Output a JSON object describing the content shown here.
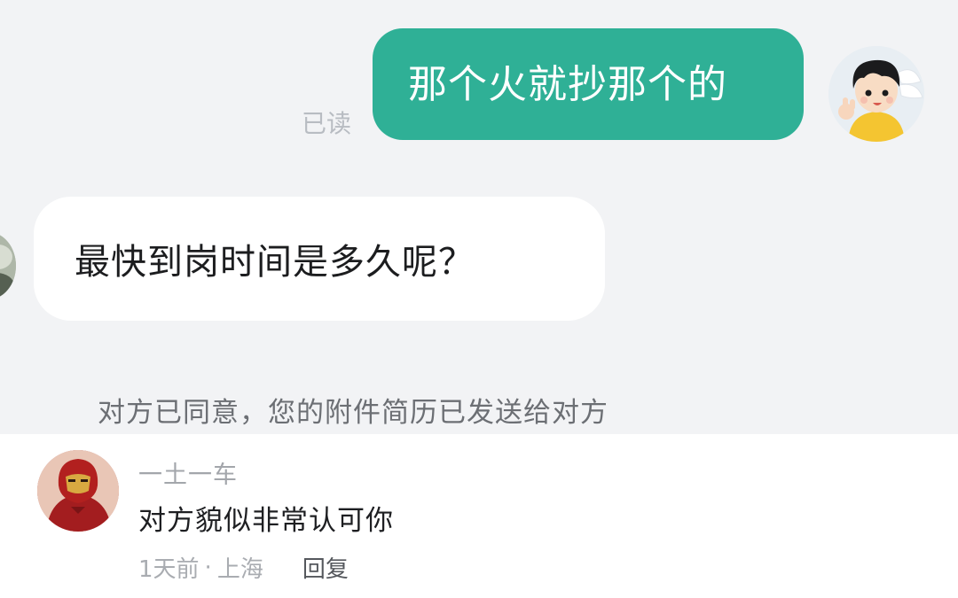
{
  "chat": {
    "outgoing_message": "那个火就抄那个的",
    "read_status": "已读",
    "incoming_message": "最快到岗时间是多久呢？",
    "system_note": "对方已同意，您的附件简历已发送给对方"
  },
  "comment": {
    "username": "一土一车",
    "text": "对方貌似非常认可你",
    "time": "1天前",
    "separator": "·",
    "location": "上海",
    "reply_label": "回复"
  },
  "colors": {
    "outgoing_bubble": "#2fb096",
    "chat_background": "#f2f3f5",
    "incoming_bubble": "#ffffff"
  },
  "icons": {
    "my_avatar": "cartoon-boy-avatar",
    "partner_avatar": "partial-avatar",
    "commenter_avatar": "red-armored-hero-avatar"
  }
}
